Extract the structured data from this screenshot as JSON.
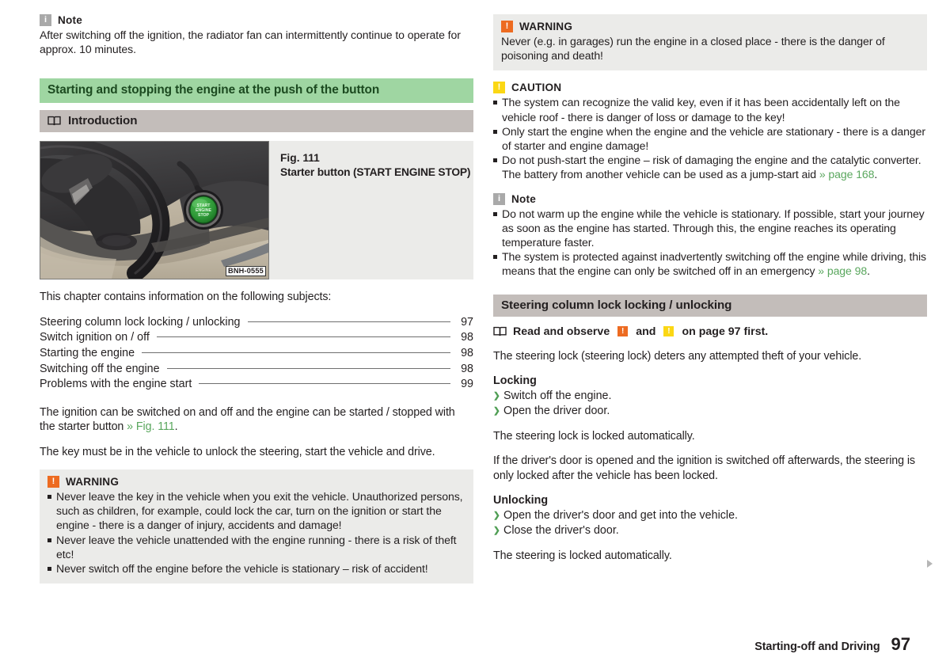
{
  "left": {
    "note": {
      "icon": "info-icon",
      "title": "Note",
      "text": "After switching off the ignition, the radiator fan can intermittently continue to operate for approx. 10 minutes."
    },
    "section_band": "Starting and stopping the engine at the push of the button",
    "subsection_band": "Introduction",
    "figure": {
      "number": "Fig. 111",
      "caption": "Starter button (START ENGINE STOP)",
      "image_code": "BNH-0555",
      "button_label_line1": "START",
      "button_label_line2": "ENGINE",
      "button_label_line3": "STOP"
    },
    "toc_intro": "This chapter contains information on the following subjects:",
    "toc": [
      {
        "label": "Steering column lock locking / unlocking",
        "page": "97"
      },
      {
        "label": "Switch ignition on / off",
        "page": "98"
      },
      {
        "label": "Starting the engine",
        "page": "98"
      },
      {
        "label": "Switching off the engine",
        "page": "98"
      },
      {
        "label": "Problems with the engine start",
        "page": "99"
      }
    ],
    "para_ignition_a": "The ignition can be switched on and off and the engine can be started / stopped with the starter button ",
    "para_ignition_link": "» Fig. 111",
    "para_ignition_b": ".",
    "para_key": "The key must be in the vehicle to unlock the steering, start the vehicle and drive.",
    "warning": {
      "title": "WARNING",
      "items": [
        "Never leave the key in the vehicle when you exit the vehicle. Unauthorized persons, such as children, for example, could lock the car, turn on the ignition or start the engine - there is a danger of injury, accidents and damage!",
        "Never leave the vehicle unattended with the engine running - there is a risk of theft etc!",
        "Never switch off the engine before the vehicle is stationary – risk of accident!"
      ]
    }
  },
  "right": {
    "warning": {
      "title": "WARNING",
      "text": "Never (e.g. in garages) run the engine in a closed place - there is the danger of poisoning and death!"
    },
    "caution": {
      "title": "CAUTION",
      "items": [
        {
          "text": "The system can recognize the valid key, even if it has been accidentally left on the vehicle roof - there is danger of loss or damage to the key!",
          "link": "",
          "tail": ""
        },
        {
          "text": "Only start the engine when the engine and the vehicle are stationary - there is a danger of starter and engine damage!",
          "link": "",
          "tail": ""
        },
        {
          "text": "Do not push-start the engine – risk of damaging the engine and the catalytic converter. The battery from another vehicle can be used as a jump-start aid ",
          "link": "» page 168",
          "tail": "."
        }
      ]
    },
    "note": {
      "title": "Note",
      "items": [
        {
          "text": "Do not warm up the engine while the vehicle is stationary. If possible, start your journey as soon as the engine has started. Through this, the engine reaches its operating temperature faster.",
          "link": "",
          "tail": ""
        },
        {
          "text": "The system is protected against inadvertently switching off the engine while driving, this means that the engine can only be switched off in an emergency ",
          "link": "» page 98",
          "tail": "."
        }
      ]
    },
    "section_band": "Steering column lock locking / unlocking",
    "read_observe_a": "Read and observe",
    "read_observe_and": "and",
    "read_observe_b": "on page 97 first.",
    "para_lock": "The steering lock (steering lock) deters any attempted theft of your vehicle.",
    "locking_title": "Locking",
    "locking_steps": [
      "Switch off the engine.",
      "Open the driver door."
    ],
    "para_locked_auto": "The steering lock is locked automatically.",
    "para_door_open": "If the driver's door is opened and the ignition is switched off afterwards, the steering is only locked after the vehicle has been locked.",
    "unlocking_title": "Unlocking",
    "unlocking_steps": [
      "Open the driver's door and get into the vehicle.",
      "Close the driver's door."
    ],
    "para_steering_locked": "The steering is locked automatically."
  },
  "footer": {
    "chapter": "Starting-off and Driving",
    "page": "97"
  },
  "colors": {
    "band_green": "#9fd6a2",
    "band_gray": "#c3bdba",
    "callout_bg": "#ebebe9",
    "warning_orange": "#ed6b21",
    "caution_yellow": "#fbd714",
    "note_gray": "#a9a9a9",
    "link_green": "#5aa75e"
  }
}
